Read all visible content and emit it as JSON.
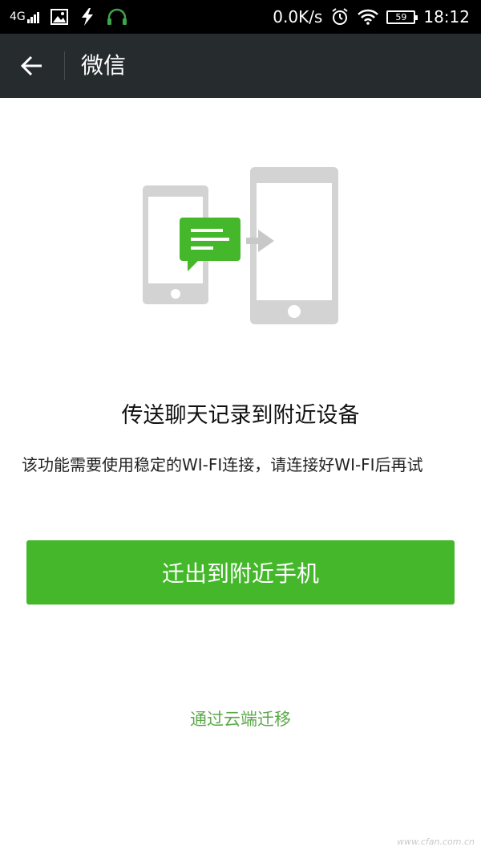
{
  "status_bar": {
    "network": "4G",
    "speed": "0.0K/s",
    "battery": "59",
    "time": "18:12",
    "icons": [
      "signal-icon",
      "image-icon",
      "flash-icon",
      "headset-icon",
      "alarm-icon",
      "wifi-icon",
      "battery-icon"
    ]
  },
  "nav": {
    "title": "微信",
    "back_icon": "back-arrow-icon"
  },
  "main": {
    "illustration": "transfer-phones-illustration",
    "headline": "传送聊天记录到附近设备",
    "description": "该功能需要使用稳定的WI-FI连接，请连接好WI-FI后再试",
    "primary_button": "迁出到附近手机",
    "secondary_link": "通过云端迁移"
  },
  "watermark": "www.cfan.com.cn",
  "colors": {
    "accent": "#44b72b",
    "link": "#5aa948",
    "nav_bg": "#262b2e",
    "status_bg": "#000000"
  }
}
